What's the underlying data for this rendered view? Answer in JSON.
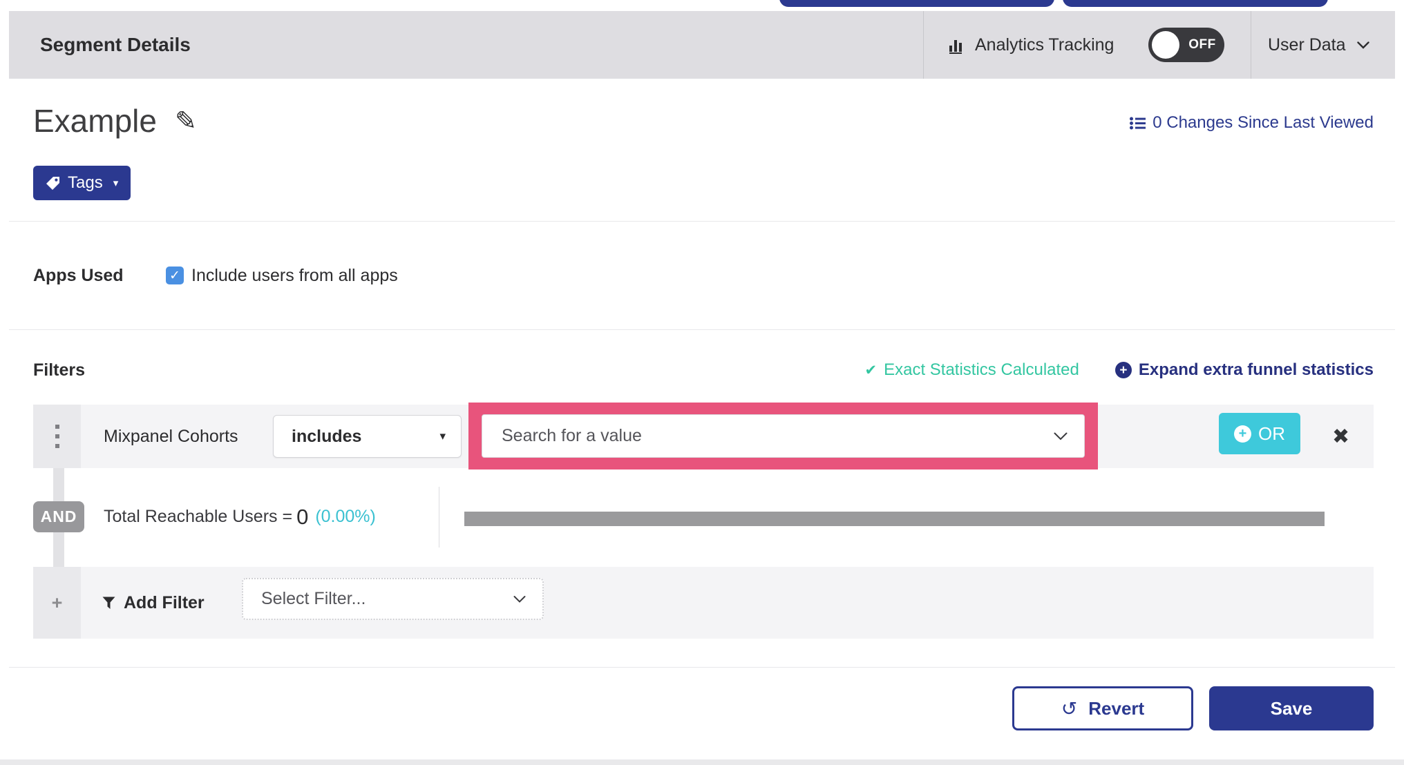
{
  "header": {
    "title": "Segment Details",
    "analytics_label": "Analytics Tracking",
    "toggle_state": "OFF",
    "user_data_label": "User Data"
  },
  "segment": {
    "name": "Example",
    "changes_link": "0 Changes Since Last Viewed",
    "tags_label": "Tags"
  },
  "apps": {
    "label": "Apps Used",
    "checkbox_label": "Include users from all apps",
    "checkbox_checked": true
  },
  "filters": {
    "title": "Filters",
    "exact_stats": "Exact Statistics Calculated",
    "expand_link": "Expand extra funnel statistics",
    "row": {
      "field": "Mixpanel Cohorts",
      "operator": "includes",
      "value_placeholder": "Search for a value",
      "or_label": "OR"
    },
    "conjunction": "AND",
    "total": {
      "label": "Total Reachable Users =",
      "value": "0",
      "percent": "(0.00%)"
    },
    "add": {
      "label": "Add Filter",
      "placeholder": "Select Filter..."
    }
  },
  "footer": {
    "revert": "Revert",
    "save": "Save"
  },
  "icons": {
    "pencil": "✎",
    "caret_down": "▾",
    "check": "✔",
    "box_check": "✓",
    "plus": "+",
    "close": "✖",
    "revert": "↺"
  },
  "colors": {
    "brand_indigo": "#2b3990",
    "link_blue": "#2c3a8e",
    "teal_success": "#33c6a1",
    "cyan_accent": "#3ec9db",
    "pink_highlight": "#e8547c",
    "checkbox_blue": "#4a90e2",
    "header_gray": "#dedde1",
    "row_gray": "#f4f4f6",
    "bar_gray": "#9a9a9c",
    "toggle_dark": "#39393d"
  }
}
